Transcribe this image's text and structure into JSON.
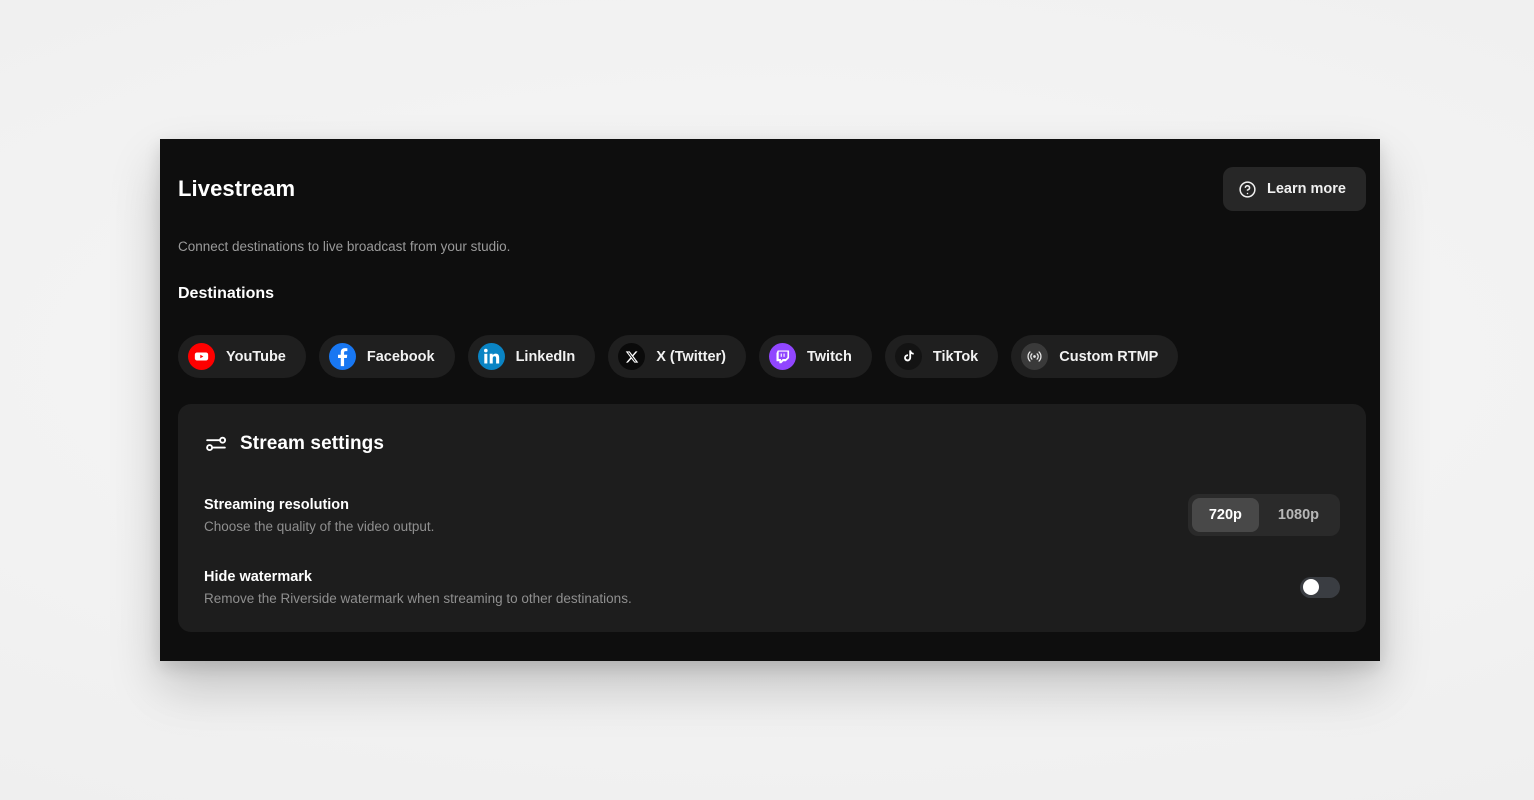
{
  "theme": {
    "page_background": "#f2f2f2",
    "window_background": "#0e0e0e",
    "card_background": "#1d1d1d",
    "chip_background": "#1f1f1f",
    "text_primary": "#ffffff",
    "text_muted": "#9a9a9a"
  },
  "header": {
    "title": "Livestream",
    "learn_more_label": "Learn more",
    "help_icon": "question-circle-icon"
  },
  "subtitle": "Connect destinations to live broadcast from your studio.",
  "destinations": {
    "section_title": "Destinations",
    "items": [
      {
        "label": "YouTube",
        "icon": "youtube-icon",
        "badge_color": "#ff0000"
      },
      {
        "label": "Facebook",
        "icon": "facebook-icon",
        "badge_color": "#1877f2"
      },
      {
        "label": "LinkedIn",
        "icon": "linkedin-icon",
        "badge_color": "#0a84c4"
      },
      {
        "label": "X (Twitter)",
        "icon": "x-twitter-icon",
        "badge_color": "#0a0a0a"
      },
      {
        "label": "Twitch",
        "icon": "twitch-icon",
        "badge_color": "#9146ff"
      },
      {
        "label": "TikTok",
        "icon": "tiktok-icon",
        "badge_color": "#131313"
      },
      {
        "label": "Custom RTMP",
        "icon": "broadcast-icon",
        "badge_color": "#3a3a3a"
      }
    ]
  },
  "stream_settings": {
    "title": "Stream settings",
    "icon": "sliders-icon",
    "resolution": {
      "title": "Streaming resolution",
      "description": "Choose the quality of the video output.",
      "options": [
        "720p",
        "1080p"
      ],
      "selected": "720p"
    },
    "watermark": {
      "title": "Hide watermark",
      "description": "Remove the Riverside watermark when streaming to other destinations.",
      "enabled": false
    }
  }
}
